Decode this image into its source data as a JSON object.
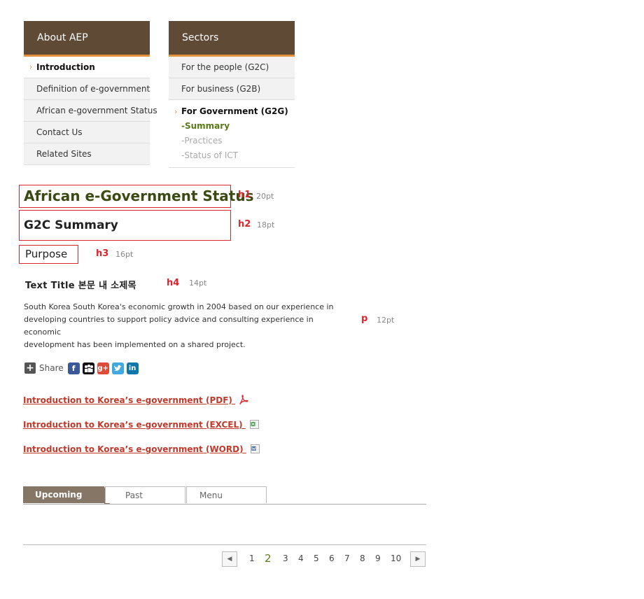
{
  "about_menu": {
    "header": "About AEP",
    "items": [
      "Introduction",
      "Definition of e-government",
      "African e-government Status",
      "Contact Us",
      "Related Sites"
    ]
  },
  "sectors_menu": {
    "header": "Sectors",
    "items": [
      "For the people (G2C)",
      "For business (G2B)"
    ],
    "active": "For Government (G2G)",
    "sub_items": [
      "-Summary",
      "-Practices",
      "-Status of ICT"
    ]
  },
  "samples": {
    "h1": {
      "text": "African e-Government Status",
      "tag": "h1",
      "size": "20pt"
    },
    "h2": {
      "text": "G2C Summary",
      "tag": "h2",
      "size": "18pt"
    },
    "h3": {
      "text": "Purpose",
      "tag": "h3",
      "size": "16pt"
    },
    "h4": {
      "text": "Text Title  본문 내 소제목",
      "tag": "h4",
      "size": "14pt"
    },
    "p": {
      "lines": [
        "South Korea South Korea's economic growth in 2004 based on our experience in",
        "developing countries to support policy advice and consulting experience in economic",
        "development has been implemented on a shared project."
      ],
      "tag": "p",
      "size": "12pt"
    }
  },
  "share": {
    "label": "Share",
    "icons": [
      "facebook-icon",
      "myspace-icon",
      "google-plus-icon",
      "twitter-icon",
      "linkedin-icon"
    ]
  },
  "downloads": [
    "Introduction to Korea’s e-government (PDF)",
    "Introduction to Korea’s e-government (EXCEL)",
    "Introduction to Korea’s e-government (WORD)"
  ],
  "tabs": [
    "Upcoming",
    "Past",
    "Menu"
  ],
  "pagination": {
    "pages": [
      "1",
      "2",
      "3",
      "4",
      "5",
      "6",
      "7",
      "8",
      "9",
      "10"
    ],
    "current": "2"
  },
  "colors": {
    "menu_header": "#5f4a36",
    "accent_orange": "#e3913a",
    "label_red": "#d9252b",
    "link_red": "#c0392b",
    "summary_green": "#5a7a16"
  }
}
